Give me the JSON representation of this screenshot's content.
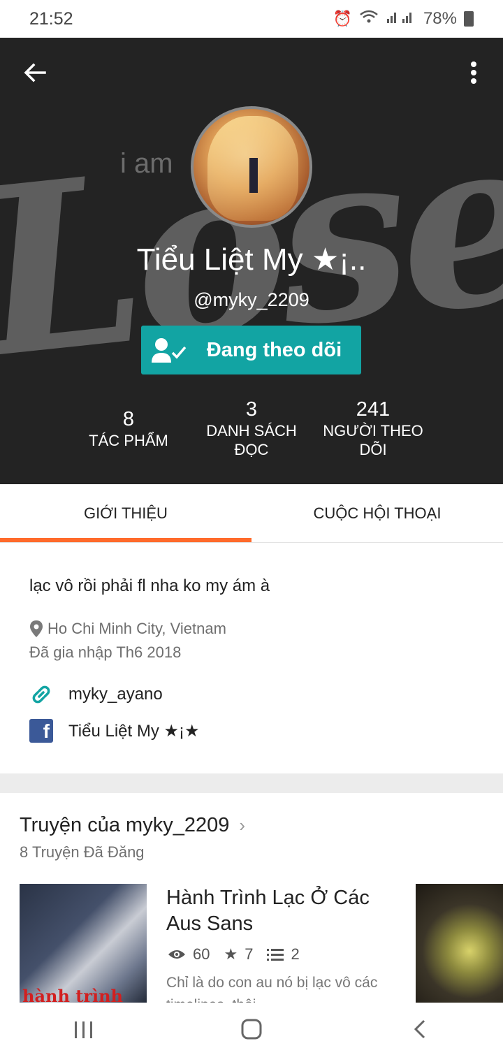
{
  "status_bar": {
    "time": "21:52",
    "battery": "78%"
  },
  "profile": {
    "display_name": "Tiểu Liệt My ★¡..",
    "username": "@myky_2209",
    "follow_label": "Đang theo dõi",
    "background_text": "Loser",
    "background_small_text": "i am"
  },
  "stats": [
    {
      "value": "8",
      "label": "TÁC PHẨM"
    },
    {
      "value": "3",
      "label": "DANH SÁCH ĐỌC"
    },
    {
      "value": "241",
      "label": "NGƯỜI THEO DÕI"
    }
  ],
  "tabs": [
    {
      "label": "GIỚI THIỆU",
      "active": true
    },
    {
      "label": "CUỘC HỘI THOẠI",
      "active": false
    }
  ],
  "about": {
    "bio": "lạc vô rồi phải fl nha ko my ám à",
    "location": "Ho Chi Minh City, Vietnam",
    "joined": "Đã gia nhập Th6 2018",
    "link_text": "myky_ayano",
    "facebook_text": "Tiểu Liệt My ★¡★"
  },
  "stories": {
    "title": "Truyện của myky_2209",
    "count_label": "8 Truyện Đã Đăng",
    "items": [
      {
        "title": "Hành Trình Lạc Ở Các Aus Sans",
        "reads": "60",
        "votes": "7",
        "parts": "2",
        "description": "Chỉ là do con au nó bị lạc vô các timelines, thôi",
        "cover_text": "hành trình"
      }
    ]
  },
  "colors": {
    "accent": "#12a4a3",
    "tab_indicator": "#ff6a2b",
    "hero_bg": "#232323"
  }
}
